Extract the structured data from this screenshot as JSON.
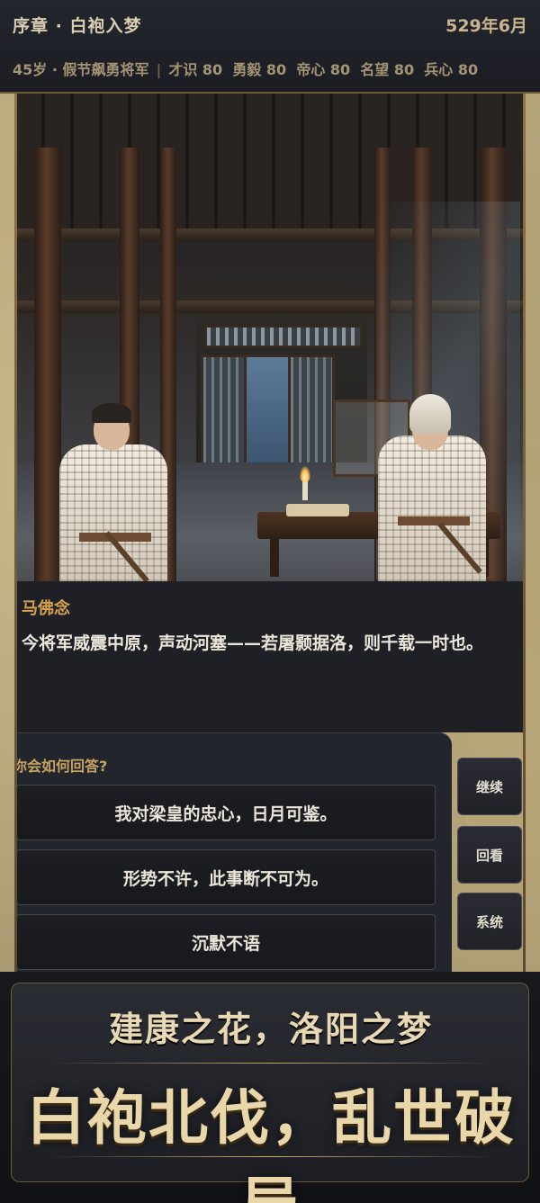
{
  "header": {
    "chapter": "序章 · 白袍入梦",
    "date": "529年6月",
    "age_title": "45岁 · 假节飙勇将军",
    "stats": [
      "才识 80",
      "勇毅 80",
      "帝心 80",
      "名望 80",
      "兵心 80"
    ]
  },
  "dialog": {
    "speaker": "马佛念",
    "text": "今将军威震中原，声动河塞——若屠颢据洛，则千载一时也。"
  },
  "choices": {
    "question": "你会如何回答?",
    "options": [
      "我对梁皇的忠心，日月可鉴。",
      "形势不许，此事断不可为。",
      "沉默不语"
    ]
  },
  "side_buttons": {
    "continue": "继续",
    "review": "回看",
    "system": "系统"
  },
  "banner": {
    "subtitle": "建康之花，洛阳之梦",
    "title": "白袍北伐，乱世破局"
  },
  "colors": {
    "speaker": "#d7a24e",
    "question": "#c7a463",
    "gold_border": "#6d5a38",
    "panel": "#23252c"
  }
}
